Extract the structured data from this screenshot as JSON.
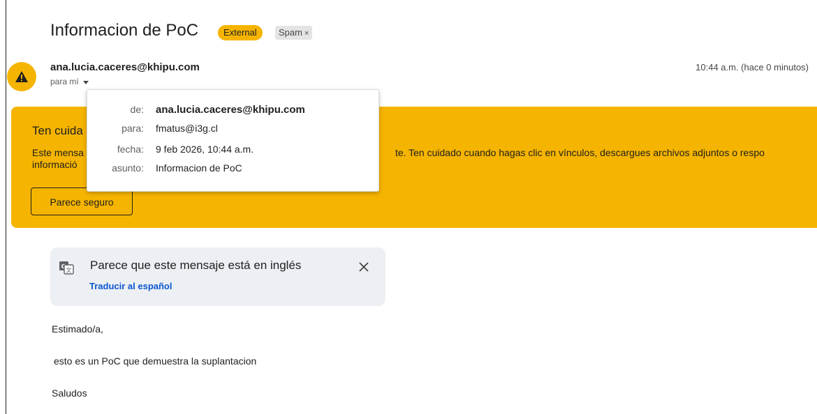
{
  "email": {
    "subject": "Informacion de PoC",
    "labels": {
      "external": "External",
      "spam": "Spam",
      "spam_remove": "×"
    },
    "sender": "ana.lucia.caceres@khipu.com",
    "recipient_summary": "para mí",
    "timestamp": "10:44 a.m. (hace 0 minutos)"
  },
  "warning": {
    "title": "Ten cuida",
    "text_start": "Este mensa",
    "text_end": "te. Ten cuidado cuando hagas clic en vínculos, descargues archivos adjuntos o respo",
    "text_line2": "informació",
    "button_label": "Parece seguro",
    "color": "#f5b400"
  },
  "details_popup": {
    "from_label": "de:",
    "from_value": "ana.lucia.caceres@khipu.com",
    "to_label": "para:",
    "to_value": "fmatus@i3g.cl",
    "date_label": "fecha:",
    "date_value": "9 feb 2026, 10:44 a.m.",
    "subject_label": "asunto:",
    "subject_value": "Informacion de PoC"
  },
  "translate": {
    "message": "Parece que este mensaje está en inglés",
    "link": "Traducir al español",
    "close": "✕",
    "link_color": "#0b57d0"
  },
  "body": {
    "greeting": "Estimado/a,",
    "line1": "esto es un PoC que demuestra la suplantacion",
    "closing": "Saludos"
  }
}
